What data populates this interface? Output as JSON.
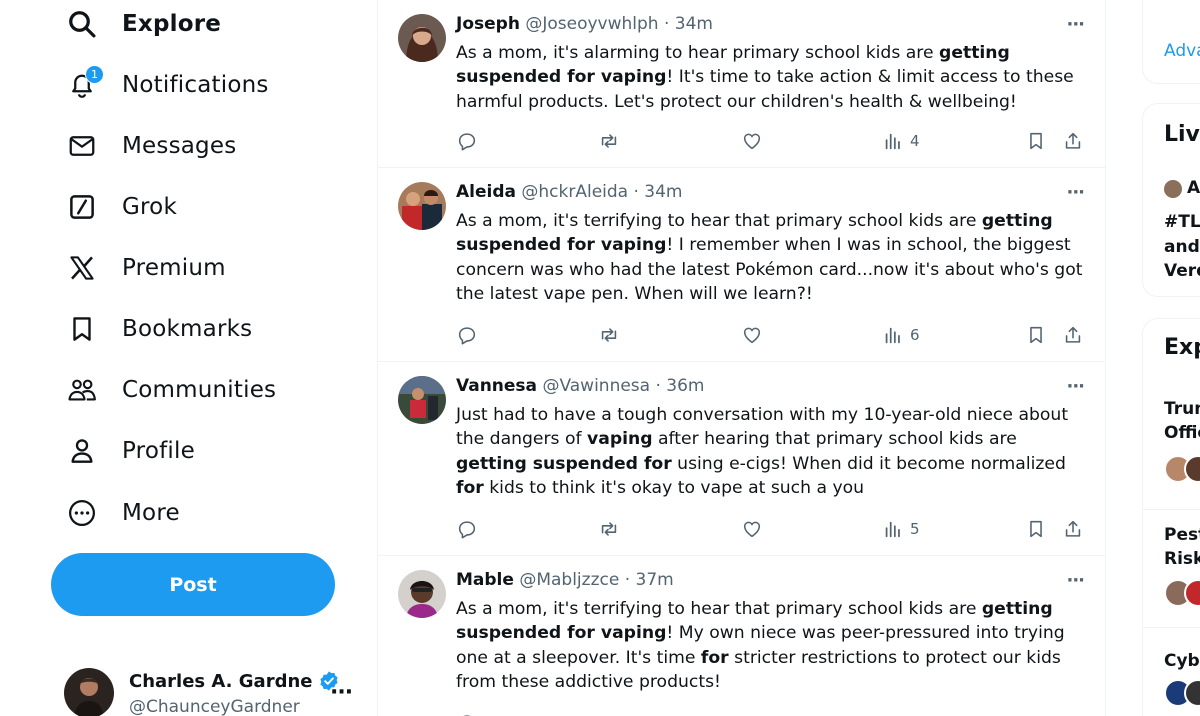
{
  "nav": {
    "items": [
      {
        "label": "Explore",
        "icon": "search-icon"
      },
      {
        "label": "Notifications",
        "icon": "bell-icon",
        "badge": "1"
      },
      {
        "label": "Messages",
        "icon": "envelope-icon"
      },
      {
        "label": "Grok",
        "icon": "grok-icon"
      },
      {
        "label": "Premium",
        "icon": "x-logo-icon"
      },
      {
        "label": "Bookmarks",
        "icon": "bookmark-icon"
      },
      {
        "label": "Communities",
        "icon": "people-icon"
      },
      {
        "label": "Profile",
        "icon": "person-icon"
      },
      {
        "label": "More",
        "icon": "more-circle-icon"
      }
    ],
    "post_label": "Post"
  },
  "account": {
    "name": "Charles A. Gardne",
    "handle": "@ChaunceyGardner",
    "more": "···"
  },
  "tweets": [
    {
      "name": "Joseph",
      "meta": "@Joseoyvwhlph · 34m",
      "text_parts": [
        {
          "t": "As a mom, it's alarming to hear primary school kids are ",
          "b": false
        },
        {
          "t": "getting suspended for vaping",
          "b": true
        },
        {
          "t": "! It's time to take action & limit access to these harmful products. Let's protect our children's health & wellbeing!",
          "b": false
        }
      ],
      "views": "4"
    },
    {
      "name": "Aleida",
      "meta": "@hckrAleida · 34m",
      "text_parts": [
        {
          "t": "As a mom, it's terrifying to hear that primary school kids are ",
          "b": false
        },
        {
          "t": "getting suspended for vaping",
          "b": true
        },
        {
          "t": "! I remember when I was in school, the biggest concern was who had the latest Pokémon card...now it's about who's got the latest vape pen. When will we learn?!",
          "b": false
        }
      ],
      "views": "6"
    },
    {
      "name": "Vannesa",
      "meta": "@Vawinnesa · 36m",
      "text_parts": [
        {
          "t": "Just had to have a tough conversation with my 10-year-old niece about the dangers of ",
          "b": false
        },
        {
          "t": "vaping",
          "b": true
        },
        {
          "t": " after hearing that primary school kids are ",
          "b": false
        },
        {
          "t": "getting suspended for",
          "b": true
        },
        {
          "t": " using e-cigs! When did it become normalized ",
          "b": false
        },
        {
          "t": "for",
          "b": true
        },
        {
          "t": " kids to think it's okay to vape at such a you",
          "b": false
        }
      ],
      "views": "5"
    },
    {
      "name": "Mable",
      "meta": "@Mabljzzce · 37m",
      "text_parts": [
        {
          "t": "As a mom, it's terrifying to hear that primary school kids are ",
          "b": false
        },
        {
          "t": "getting suspended for vaping",
          "b": true
        },
        {
          "t": "! My own niece was peer-pressured into trying one at a sleepover. It's time ",
          "b": false
        },
        {
          "t": "for",
          "b": true
        },
        {
          "t": " stricter restrictions to protect our kids from these addictive products!",
          "b": false
        }
      ],
      "views": ""
    }
  ],
  "right": {
    "advanced_link": "Adva",
    "live_heading": "Live",
    "live_user": "A",
    "live_lines": [
      "#TL",
      "and",
      "Verd"
    ],
    "explore_heading": "Exp",
    "explore_items": [
      [
        "Trum",
        "Offic"
      ],
      [
        "Pest",
        "Risk"
      ],
      [
        "Cybe"
      ]
    ]
  },
  "colors": {
    "accent": "#1d9bf0",
    "muted": "#536471",
    "text": "#0f1419",
    "border": "#eff3f4"
  }
}
